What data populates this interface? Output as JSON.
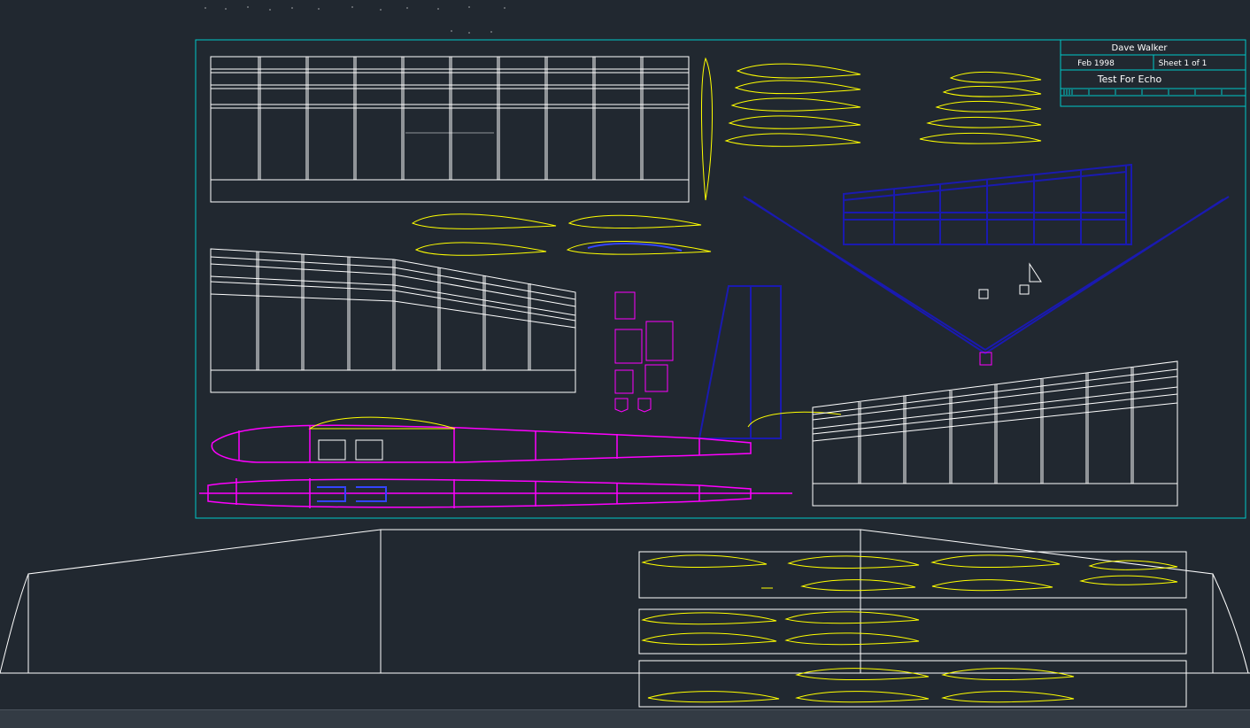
{
  "title_block": {
    "author": "Dave Walker",
    "date": "Feb 1998",
    "sheet": "Sheet 1 of 1",
    "project": "Test For Echo"
  },
  "colors": {
    "background": "#212830",
    "frame": "#00c8c8",
    "structure": "#ffffff",
    "airfoil_ribs": "#ffff00",
    "fuselage": "#ff00ff",
    "stabilizer": "#1a1ab0",
    "fin": "#1a1ab0"
  },
  "drawing": {
    "sheet_border": "drawing-frame",
    "views": [
      "wing-plan-top",
      "wing-plan-middle",
      "stabilizer-plan",
      "wing-plan-right",
      "fuselage-side",
      "fuselage-top",
      "fin-side",
      "rib-sets",
      "former-sets",
      "full-wing-outline",
      "rib-template-panels"
    ]
  }
}
